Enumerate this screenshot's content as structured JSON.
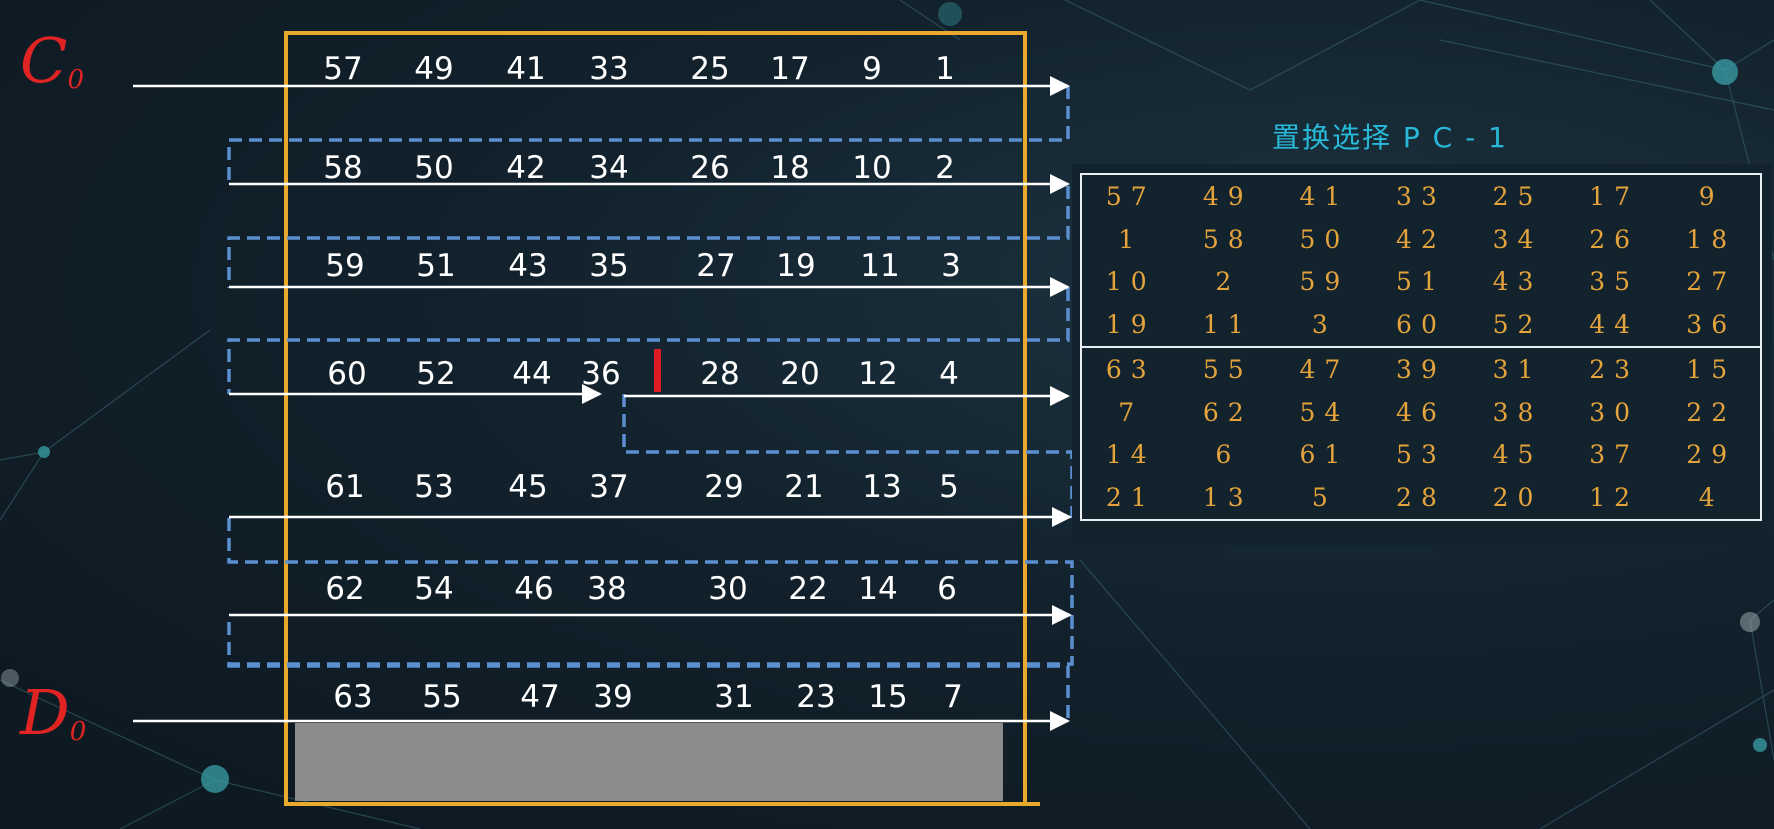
{
  "labels": {
    "c_main": "C",
    "c_sub": "0",
    "d_main": "D",
    "d_sub": "0"
  },
  "left_grid": [
    [
      "57",
      "49",
      "41",
      "33",
      "25",
      "17",
      "9",
      "1"
    ],
    [
      "58",
      "50",
      "42",
      "34",
      "26",
      "18",
      "10",
      "2"
    ],
    [
      "59",
      "51",
      "43",
      "35",
      "27",
      "19",
      "11",
      "3"
    ],
    [
      "60",
      "52",
      "44",
      "36",
      "28",
      "20",
      "12",
      "4"
    ],
    [
      "61",
      "53",
      "45",
      "37",
      "29",
      "21",
      "13",
      "5"
    ],
    [
      "62",
      "54",
      "46",
      "38",
      "30",
      "22",
      "14",
      "6"
    ],
    [
      "63",
      "55",
      "47",
      "39",
      "31",
      "23",
      "15",
      "7"
    ]
  ],
  "pc1": {
    "title": "置换选择 P C - 1",
    "rows": [
      [
        "57",
        "49",
        "41",
        "33",
        "25",
        "17",
        "9"
      ],
      [
        "1",
        "58",
        "50",
        "42",
        "34",
        "26",
        "18"
      ],
      [
        "10",
        "2",
        "59",
        "51",
        "43",
        "35",
        "27"
      ],
      [
        "19",
        "11",
        "3",
        "60",
        "52",
        "44",
        "36"
      ],
      [
        "63",
        "55",
        "47",
        "39",
        "31",
        "23",
        "15"
      ],
      [
        "7",
        "62",
        "54",
        "46",
        "38",
        "30",
        "22"
      ],
      [
        "14",
        "6",
        "61",
        "53",
        "45",
        "37",
        "29"
      ],
      [
        "21",
        "13",
        "5",
        "28",
        "20",
        "12",
        "4"
      ]
    ]
  },
  "colors": {
    "frame": "#e9a92c",
    "dashed_path": "#5b8fd0",
    "arrow": "#ffffff",
    "red_label": "#e02424",
    "red_divider": "#e01b24",
    "pc1_title": "#28b8d8",
    "pc1_values": "#e5a33c",
    "gray_block": "#8c8c8c"
  }
}
